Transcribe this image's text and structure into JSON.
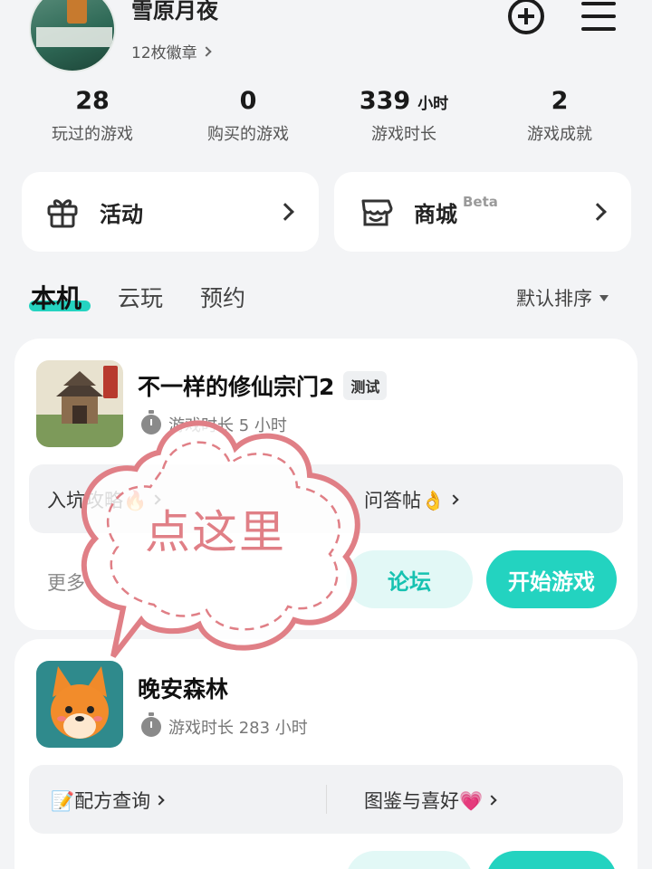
{
  "profile": {
    "name": "雪原月夜",
    "badges": "12枚徽章"
  },
  "stats": [
    {
      "value": "28",
      "unit": "",
      "label": "玩过的游戏"
    },
    {
      "value": "0",
      "unit": "",
      "label": "购买的游戏"
    },
    {
      "value": "339",
      "unit": "小时",
      "label": "游戏时长"
    },
    {
      "value": "2",
      "unit": "",
      "label": "游戏成就"
    }
  ],
  "entries": {
    "activity": "活动",
    "mall": "商城",
    "mall_badge": "Beta"
  },
  "tabs": [
    {
      "label": "本机",
      "active": true
    },
    {
      "label": "云玩",
      "active": false
    },
    {
      "label": "预约",
      "active": false
    }
  ],
  "sort": "默认排序",
  "games": [
    {
      "title": "不一样的修仙宗门2",
      "tag": "测试",
      "playtime": "游戏时长 5 小时",
      "links": [
        "入坑攻略🔥",
        "问答帖👌"
      ],
      "more": "更多",
      "forum": "论坛",
      "start": "开始游戏"
    },
    {
      "title": "晚安森林",
      "playtime": "游戏时长 283 小时",
      "links": [
        "📝配方查询",
        "图鉴与喜好💗"
      ]
    }
  ],
  "overlay": {
    "text": "点这里",
    "color": "#e07f86"
  },
  "colors": {
    "accent": "#23d3c0",
    "background": "#f3f4f6"
  }
}
